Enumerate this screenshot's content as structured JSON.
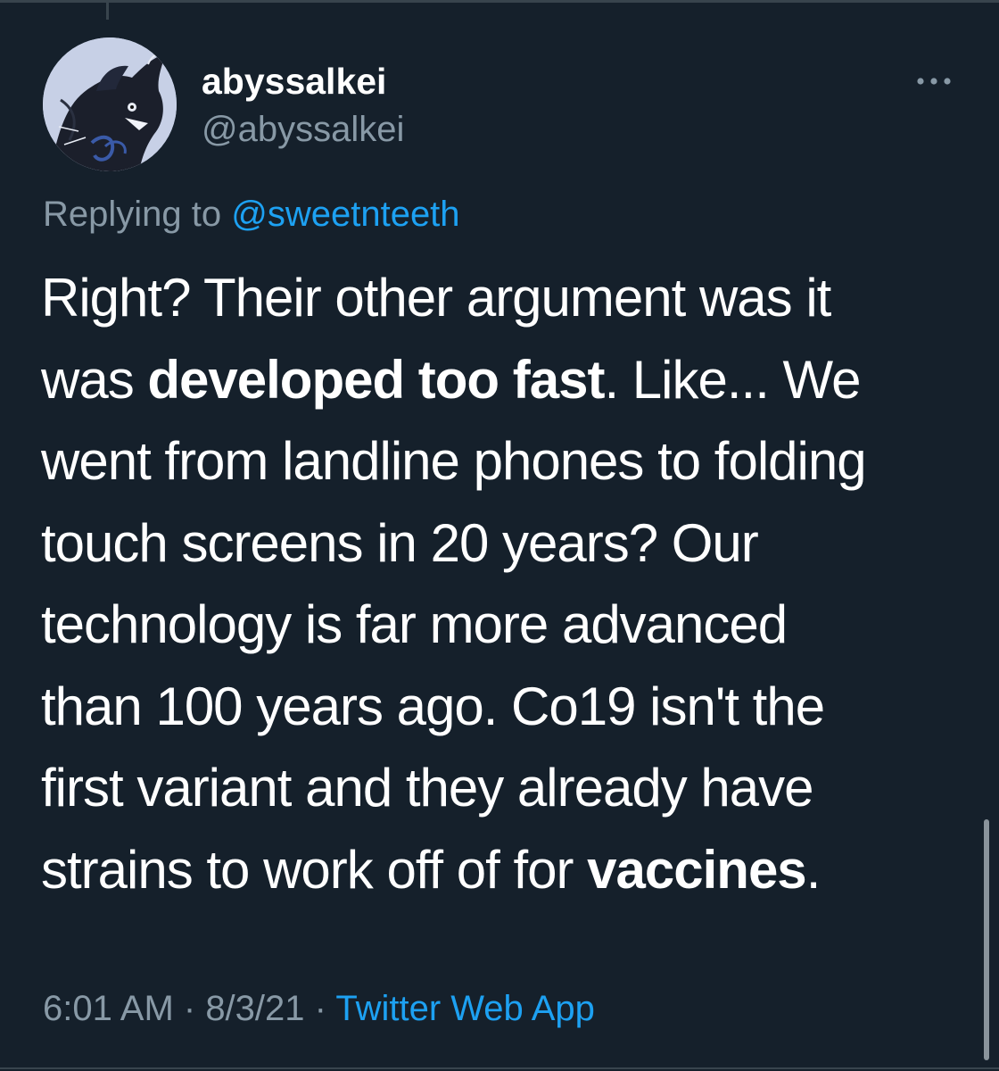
{
  "tweet": {
    "display_name": "abyssalkei",
    "handle": "@abyssalkei",
    "replying_prefix": "Replying to ",
    "replying_to": "@sweetnteeth",
    "body": {
      "line1": "Right? Their other argument was it",
      "line2_pre": "was ",
      "line2_bold": "developed too fast",
      "line2_post": ". Like... We",
      "line3": "went from landline phones to folding",
      "line4": "touch screens in 20 years? Our",
      "line5": "technology is far more advanced",
      "line6": "than 100 years ago. Co19 isn't the",
      "line7": "first variant and they already have",
      "line8_pre": "strains to work off of for ",
      "line8_bold": "vaccines",
      "line8_post": "."
    },
    "time": "6:01 AM",
    "separator": " · ",
    "date": "8/3/21",
    "source": "Twitter Web App"
  },
  "icons": {
    "more": "more-horizontal-icon",
    "avatar": "avatar-illustration"
  },
  "colors": {
    "background": "#15202b",
    "text": "#ffffff",
    "secondary": "#8899a6",
    "link": "#1da1f2",
    "border": "#38444d"
  }
}
